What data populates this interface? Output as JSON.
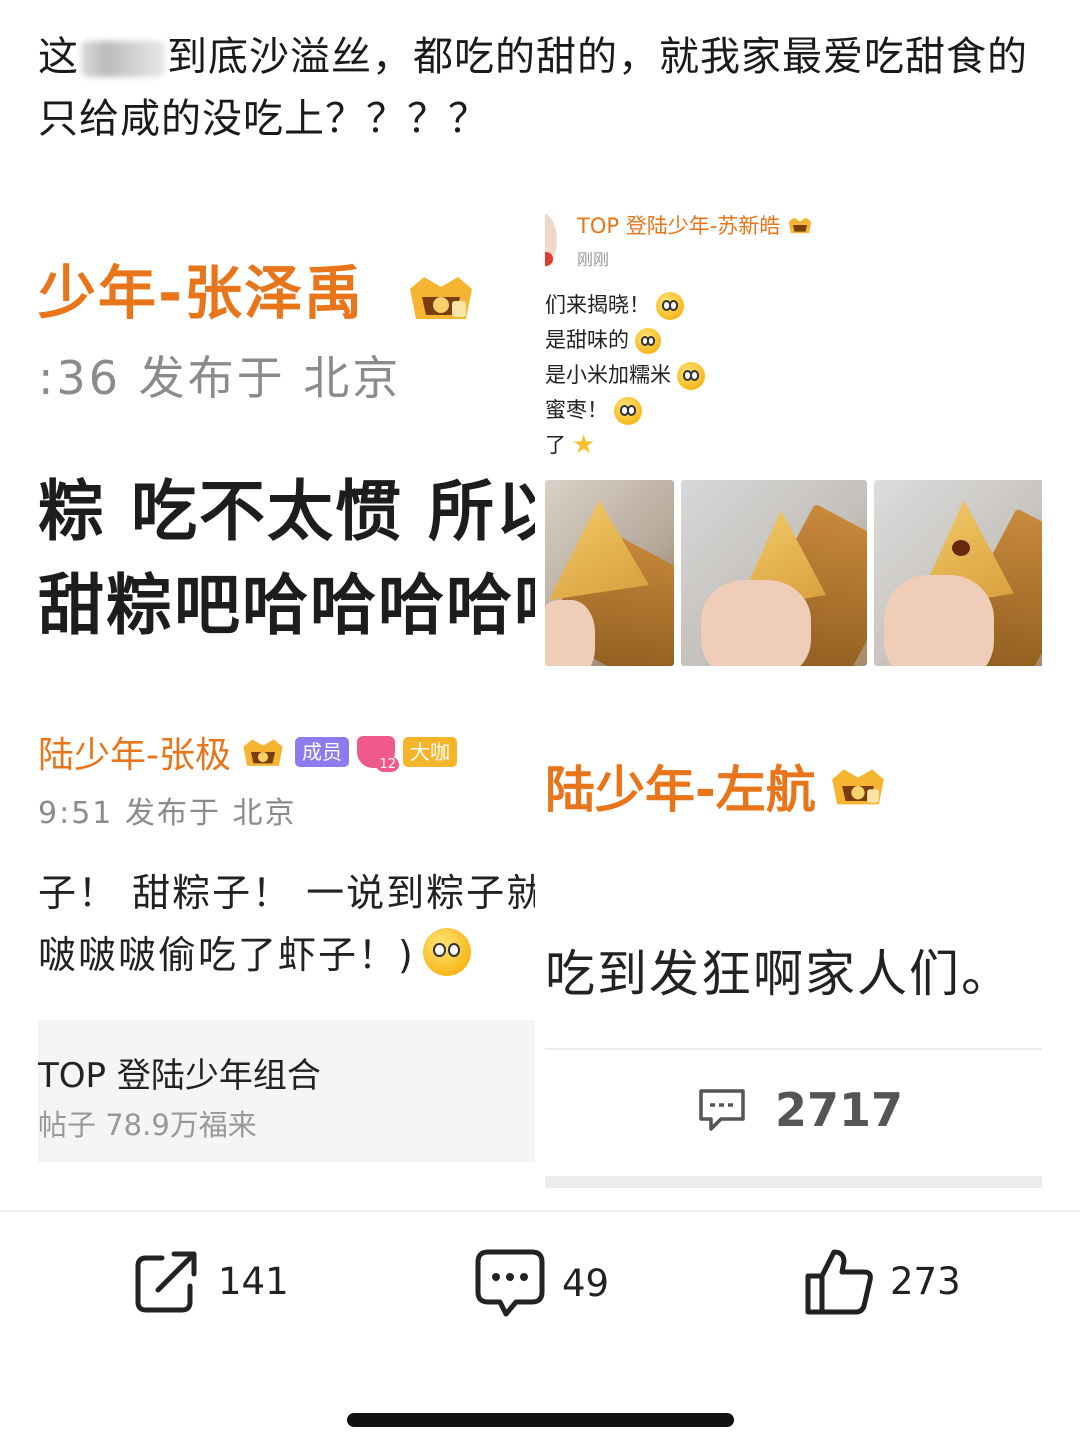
{
  "post": {
    "text_before": "这",
    "text_after": "到底沙溢丝，都吃的甜的，就我家最爱吃甜食的只给咸的没吃上？？？？"
  },
  "left_screenshot": {
    "top_post": {
      "author": "少年-张泽禹",
      "meta": ":36  发布于 北京",
      "line1": "粽 吃不太惯 所以手",
      "line2": "甜粽吧哈哈哈哈哈"
    },
    "second_post": {
      "author": "陆少年-张极",
      "badge_member": "成员",
      "badge_gem_level": "12",
      "badge_big": "大咖",
      "meta": "9:51  发布于 北京",
      "line1": "子！ 甜粽子！ 一说到粽子就",
      "line2": "啵啵啵偷吃了虾子！)"
    },
    "group": {
      "title": "TOP 登陆少年组合",
      "subtitle": "帖子 78.9万福来"
    }
  },
  "right_screenshot": {
    "top_post": {
      "author": "TOP 登陆少年-苏新皓",
      "time": "刚刚",
      "lines": [
        "们来揭晓！",
        "是甜味的",
        "是小米加糯米",
        "蜜枣！",
        "了"
      ]
    },
    "second_post": {
      "author": "陆少年-左航",
      "text": "吃到发狂啊家人们。",
      "comment_count": "2717"
    }
  },
  "actions": {
    "share_count": "141",
    "comment_count": "49",
    "like_count": "273"
  },
  "icons": {
    "share": "share-icon",
    "comment": "comment-icon",
    "like": "thumbs-up-icon",
    "crown": "crown-badge-icon"
  },
  "colors": {
    "accent_orange": "#e8751a",
    "muted_gray": "#8b8b8b"
  }
}
